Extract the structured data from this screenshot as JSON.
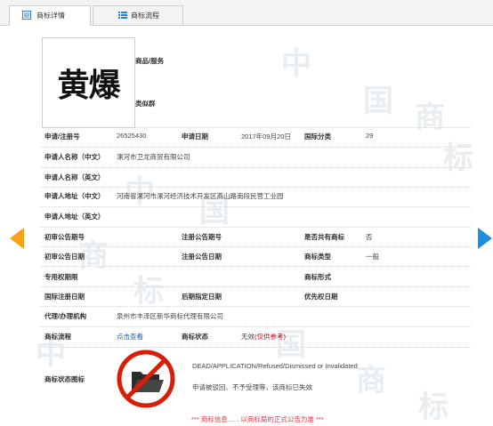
{
  "tabs": [
    {
      "label": "商标详情",
      "active": true,
      "icon": "doc-icon"
    },
    {
      "label": "商标流程",
      "active": false,
      "icon": "list-icon"
    }
  ],
  "watermark": [
    "中",
    "国",
    "商",
    "标",
    "中",
    "国",
    "商",
    "标",
    "中",
    "国",
    "商",
    "标"
  ],
  "logo_text": "黄爆",
  "goods_label": "商品/服务",
  "similar_group_label": "类似群",
  "fields": {
    "reg_no": {
      "label": "申请/注册号",
      "value": "26525430"
    },
    "app_date": {
      "label": "申请日期",
      "value": "2017年09月20日"
    },
    "intl_class": {
      "label": "国际分类",
      "value": "29"
    },
    "applicant_cn": {
      "label": "申请人名称（中文）",
      "value": "漯河市卫龙商贸有限公司"
    },
    "applicant_en": {
      "label": "申请人名称（英文）",
      "value": ""
    },
    "address_cn": {
      "label": "申请人地址（中文）",
      "value": "河南省漯河市漯河经济技术开发区燕山路南段民营工业园"
    },
    "address_en": {
      "label": "申请人地址（英文）",
      "value": ""
    },
    "prelim_issue": {
      "label": "初审公告期号",
      "value": ""
    },
    "reg_issue": {
      "label": "注册公告期号",
      "value": ""
    },
    "shared": {
      "label": "是否共有商标",
      "value": "否"
    },
    "prelim_date": {
      "label": "初审公告日期",
      "value": ""
    },
    "reg_date": {
      "label": "注册公告日期",
      "value": ""
    },
    "tm_type": {
      "label": "商标类型",
      "value": "一般"
    },
    "exclusive_period": {
      "label": "专用权期限",
      "value": ""
    },
    "tm_form": {
      "label": "商标形式",
      "value": ""
    },
    "intl_reg_date": {
      "label": "国际注册日期",
      "value": ""
    },
    "later_date": {
      "label": "后期指定日期",
      "value": ""
    },
    "priority_date": {
      "label": "优先权日期",
      "value": ""
    },
    "agency": {
      "label": "代理/办理机构",
      "value": "泉州市丰泽区新华商标代理有限公司"
    },
    "process": {
      "label": "商标流程",
      "value": "点击查看"
    },
    "status": {
      "label": "商标状态",
      "value": "无效",
      "note": "(仅供参考)"
    },
    "status_icon": {
      "label": "商标状态图标"
    }
  },
  "status_detail": {
    "en": "DEAD/APPLICATION/Refused/Dismissed or Invalidated",
    "cn": "申请被驳回、不予受理等，该商标已失效"
  },
  "bottom_partial": "*** 商标信息...... 以商标局的正式公告为准 ***",
  "colors": {
    "accent_orange": "#f7a21b",
    "accent_blue": "#1e8ee0",
    "link": "#1a66b3",
    "status_red": "#d0021b"
  }
}
